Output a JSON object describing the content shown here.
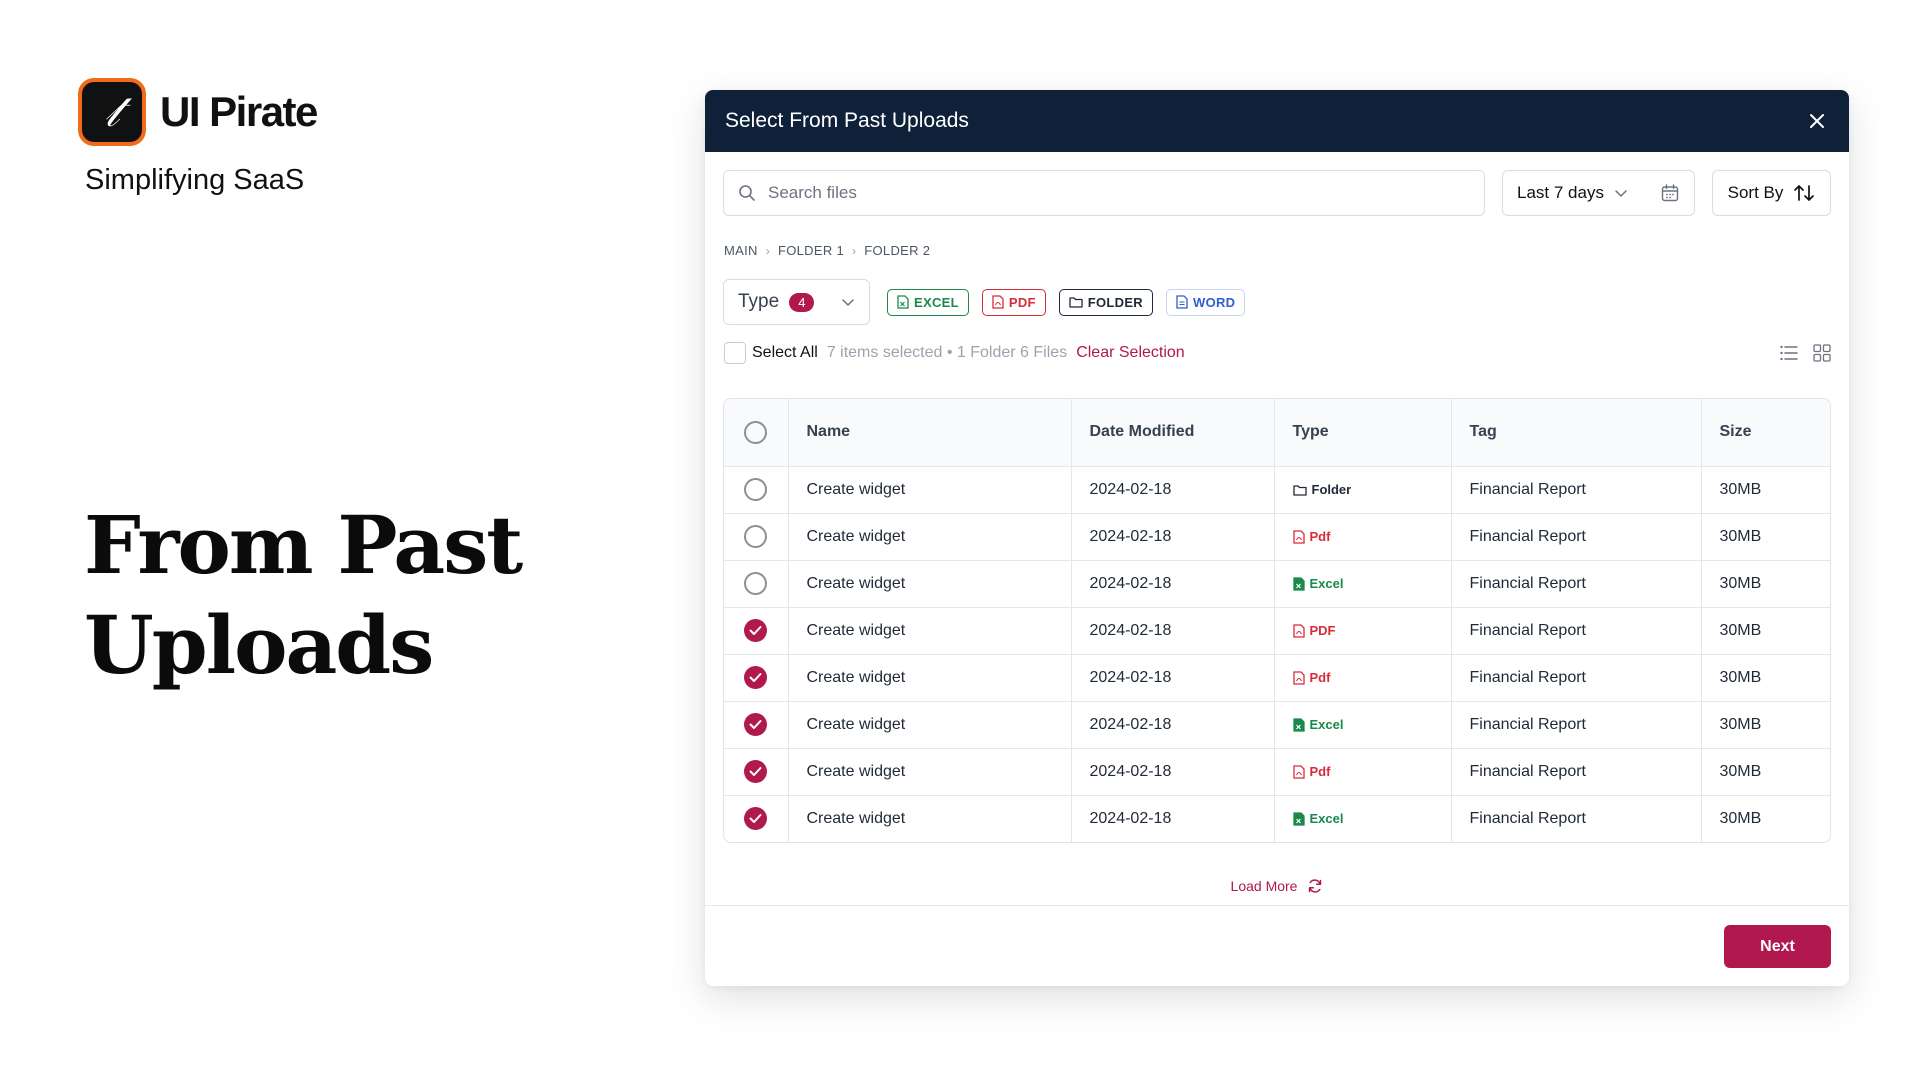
{
  "brand": {
    "name": "UI Pirate",
    "tagline": "Simplifying SaaS"
  },
  "hero": {
    "line1": "From Past",
    "line2": "Uploads"
  },
  "modal": {
    "title": "Select From Past Uploads",
    "search": {
      "placeholder": "Search files",
      "value": ""
    },
    "date_filter": "Last 7 days",
    "sort_label": "Sort By",
    "breadcrumb": [
      "MAIN",
      "FOLDER 1",
      "FOLDER 2"
    ],
    "type_filter": {
      "label": "Type",
      "count": "4"
    },
    "chips": [
      {
        "label": "EXCEL",
        "icon": "excel-file-icon",
        "color": "#1a8a4a"
      },
      {
        "label": "PDF",
        "icon": "pdf-file-icon",
        "color": "#d72b3a"
      },
      {
        "label": "FOLDER",
        "icon": "folder-icon",
        "color": "#1f2937"
      },
      {
        "label": "WORD",
        "icon": "word-file-icon",
        "color": "#2f5fd0"
      }
    ],
    "select_all_label": "Select All",
    "selection_info": "7 items selected • 1 Folder 6 Files",
    "clear_selection": "Clear Selection",
    "columns": [
      "Name",
      "Date Modified",
      "Type",
      "Tag",
      "Size"
    ],
    "rows": [
      {
        "checked": false,
        "name": "Create widget",
        "date": "2024-02-18",
        "type": "Folder",
        "kind": "folder",
        "tag": "Financial Report",
        "size": "30MB"
      },
      {
        "checked": false,
        "name": "Create widget",
        "date": "2024-02-18",
        "type": "Pdf",
        "kind": "pdf",
        "tag": "Financial Report",
        "size": "30MB"
      },
      {
        "checked": false,
        "name": "Create widget",
        "date": "2024-02-18",
        "type": "Excel",
        "kind": "excel",
        "tag": "Financial Report",
        "size": "30MB"
      },
      {
        "checked": true,
        "name": "Create widget",
        "date": "2024-02-18",
        "type": "PDF",
        "kind": "pdf",
        "tag": "Financial Report",
        "size": "30MB"
      },
      {
        "checked": true,
        "name": "Create widget",
        "date": "2024-02-18",
        "type": "Pdf",
        "kind": "pdf",
        "tag": "Financial Report",
        "size": "30MB"
      },
      {
        "checked": true,
        "name": "Create widget",
        "date": "2024-02-18",
        "type": "Excel",
        "kind": "excel",
        "tag": "Financial Report",
        "size": "30MB"
      },
      {
        "checked": true,
        "name": "Create widget",
        "date": "2024-02-18",
        "type": "Pdf",
        "kind": "pdf",
        "tag": "Financial Report",
        "size": "30MB"
      },
      {
        "checked": true,
        "name": "Create widget",
        "date": "2024-02-18",
        "type": "Excel",
        "kind": "excel",
        "tag": "Financial Report",
        "size": "30MB"
      }
    ],
    "load_more": "Load More",
    "next_label": "Next"
  },
  "colors": {
    "accent": "#b0184e",
    "header_bg": "#0f2139",
    "excel": "#1a8a4a",
    "pdf": "#d72b3a",
    "folder": "#1f2937",
    "word": "#2f5fd0",
    "logo_border": "#f26b1d"
  }
}
